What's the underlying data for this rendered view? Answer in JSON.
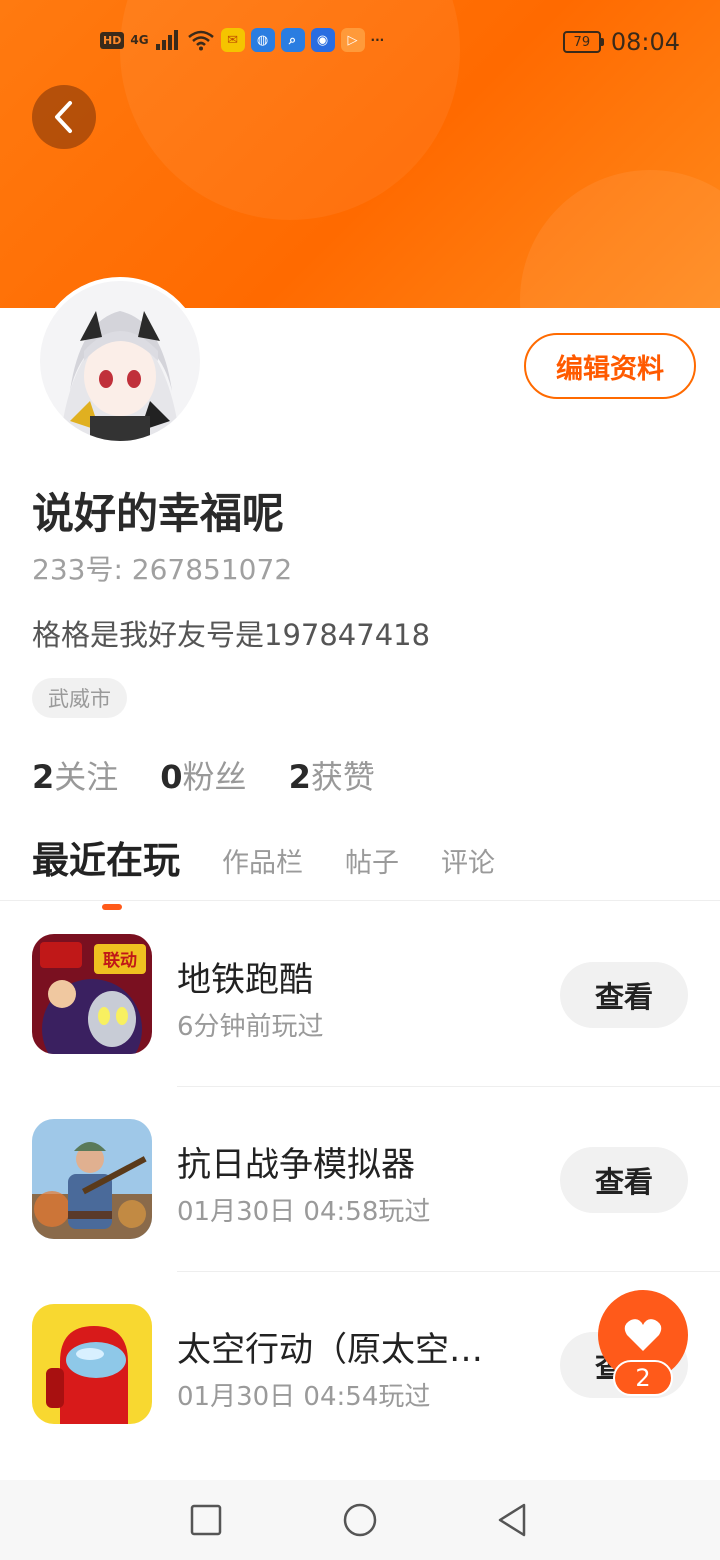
{
  "status_bar": {
    "network_badge": "HD",
    "signal_label": "4G",
    "more": "···",
    "battery": "79",
    "time": "08:04"
  },
  "profile": {
    "edit_label": "编辑资料",
    "name": "说好的幸福呢",
    "uid_label": "233号:",
    "uid_value": "267851072",
    "bio": "格格是我好友号是197847418",
    "location": "武威市",
    "stats": {
      "follow_count": "2",
      "follow_label": "关注",
      "fans_count": "0",
      "fans_label": "粉丝",
      "likes_count": "2",
      "likes_label": "获赞"
    }
  },
  "tabs": [
    {
      "label": "最近在玩",
      "active": true
    },
    {
      "label": "作品栏",
      "active": false
    },
    {
      "label": "帖子",
      "active": false
    },
    {
      "label": "评论",
      "active": false
    }
  ],
  "games": [
    {
      "title": "地铁跑酷",
      "played": "6分钟前玩过",
      "button": "查看"
    },
    {
      "title": "抗日战争模拟器",
      "played": "01月30日 04:58玩过",
      "button": "查看"
    },
    {
      "title": "太空行动（原太空…",
      "played": "01月30日 04:54玩过",
      "button": "查看"
    }
  ],
  "game_icon_text": "联动",
  "fab": {
    "count": "2"
  },
  "colors": {
    "accent": "#ff6a00",
    "header_start": "#ff7a10",
    "header_end": "#ff8a1c"
  }
}
